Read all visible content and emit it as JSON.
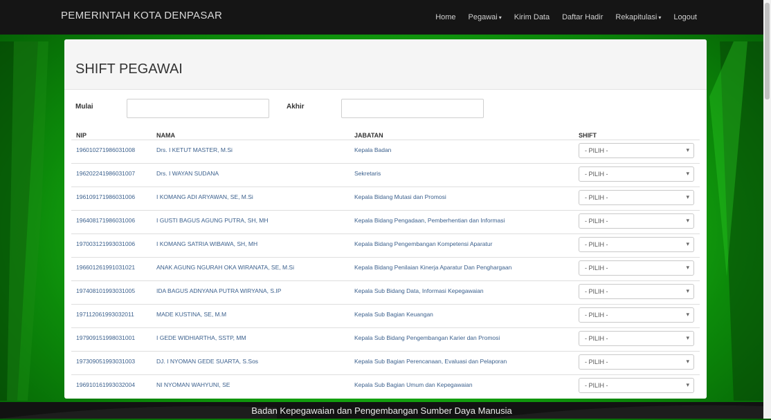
{
  "navbar": {
    "brand": "PEMERINTAH KOTA DENPASAR",
    "items": [
      {
        "label": "Home",
        "dropdown": false
      },
      {
        "label": "Pegawai",
        "dropdown": true
      },
      {
        "label": "Kirim Data",
        "dropdown": false
      },
      {
        "label": "Daftar Hadir",
        "dropdown": false
      },
      {
        "label": "Rekapitulasi",
        "dropdown": true
      },
      {
        "label": "Logout",
        "dropdown": false
      }
    ]
  },
  "panel": {
    "title": "SHIFT PEGAWAI",
    "filter": {
      "mulai_label": "Mulai",
      "mulai_value": "",
      "akhir_label": "Akhir",
      "akhir_value": ""
    },
    "table": {
      "headers": [
        "NIP",
        "NAMA",
        "JABATAN",
        "SHIFT"
      ],
      "rows": [
        {
          "nip": "196010271986031008",
          "nama": "Drs. I KETUT MASTER, M.Si",
          "jabatan": "Kepala Badan",
          "shift": "- PILIH -"
        },
        {
          "nip": "196202241986031007",
          "nama": "Drs. I WAYAN SUDANA",
          "jabatan": "Sekretaris",
          "shift": "- PILIH -"
        },
        {
          "nip": "196109171986031006",
          "nama": "I KOMANG ADI ARYAWAN, SE, M.Si",
          "jabatan": "Kepala Bidang Mutasi dan Promosi",
          "shift": "- PILIH -"
        },
        {
          "nip": "196408171986031006",
          "nama": "I GUSTI BAGUS AGUNG PUTRA, SH, MH",
          "jabatan": "Kepala Bidang Pengadaan, Pemberhentian dan Informasi",
          "shift": "- PILIH -"
        },
        {
          "nip": "197003121993031006",
          "nama": "I KOMANG SATRIA WIBAWA, SH, MH",
          "jabatan": "Kepala Bidang Pengembangan Kompetensi Aparatur",
          "shift": "- PILIH -"
        },
        {
          "nip": "196601261991031021",
          "nama": "ANAK AGUNG NGURAH OKA WIRANATA, SE, M.Si",
          "jabatan": "Kepala Bidang Penilaian Kinerja Aparatur Dan Penghargaan",
          "shift": "- PILIH -"
        },
        {
          "nip": "197408101993031005",
          "nama": "IDA BAGUS ADNYANA PUTRA WIRYANA, S.IP",
          "jabatan": "Kepala Sub Bidang Data, Informasi Kepegawaian",
          "shift": "- PILIH -"
        },
        {
          "nip": "197112061993032011",
          "nama": "MADE KUSTINA, SE, M.M",
          "jabatan": "Kepala Sub Bagian Keuangan",
          "shift": "- PILIH -"
        },
        {
          "nip": "197909151998031001",
          "nama": "I GEDE WIDHIARTHA, SSTP, MM",
          "jabatan": "Kepala Sub Bidang Pengembangan Karier dan Promosi",
          "shift": "- PILIH -"
        },
        {
          "nip": "197309051993031003",
          "nama": "DJ. I NYOMAN GEDE SUARTA, S.Sos",
          "jabatan": "Kepala Sub Bagian Perencanaan, Evaluasi dan Pelaporan",
          "shift": "- PILIH -"
        },
        {
          "nip": "196910161993032004",
          "nama": "NI NYOMAN WAHYUNI, SE",
          "jabatan": "Kepala Sub Bagian Umum dan Kepegawaian",
          "shift": "- PILIH -"
        }
      ]
    }
  },
  "footer": {
    "text": "Badan Kepegawaian dan Pengembangan Sumber Daya Manusia"
  },
  "theme": {
    "navbar_bg": "#151515",
    "background_green": "#1fbe17",
    "link_color": "#3a5f8c"
  }
}
